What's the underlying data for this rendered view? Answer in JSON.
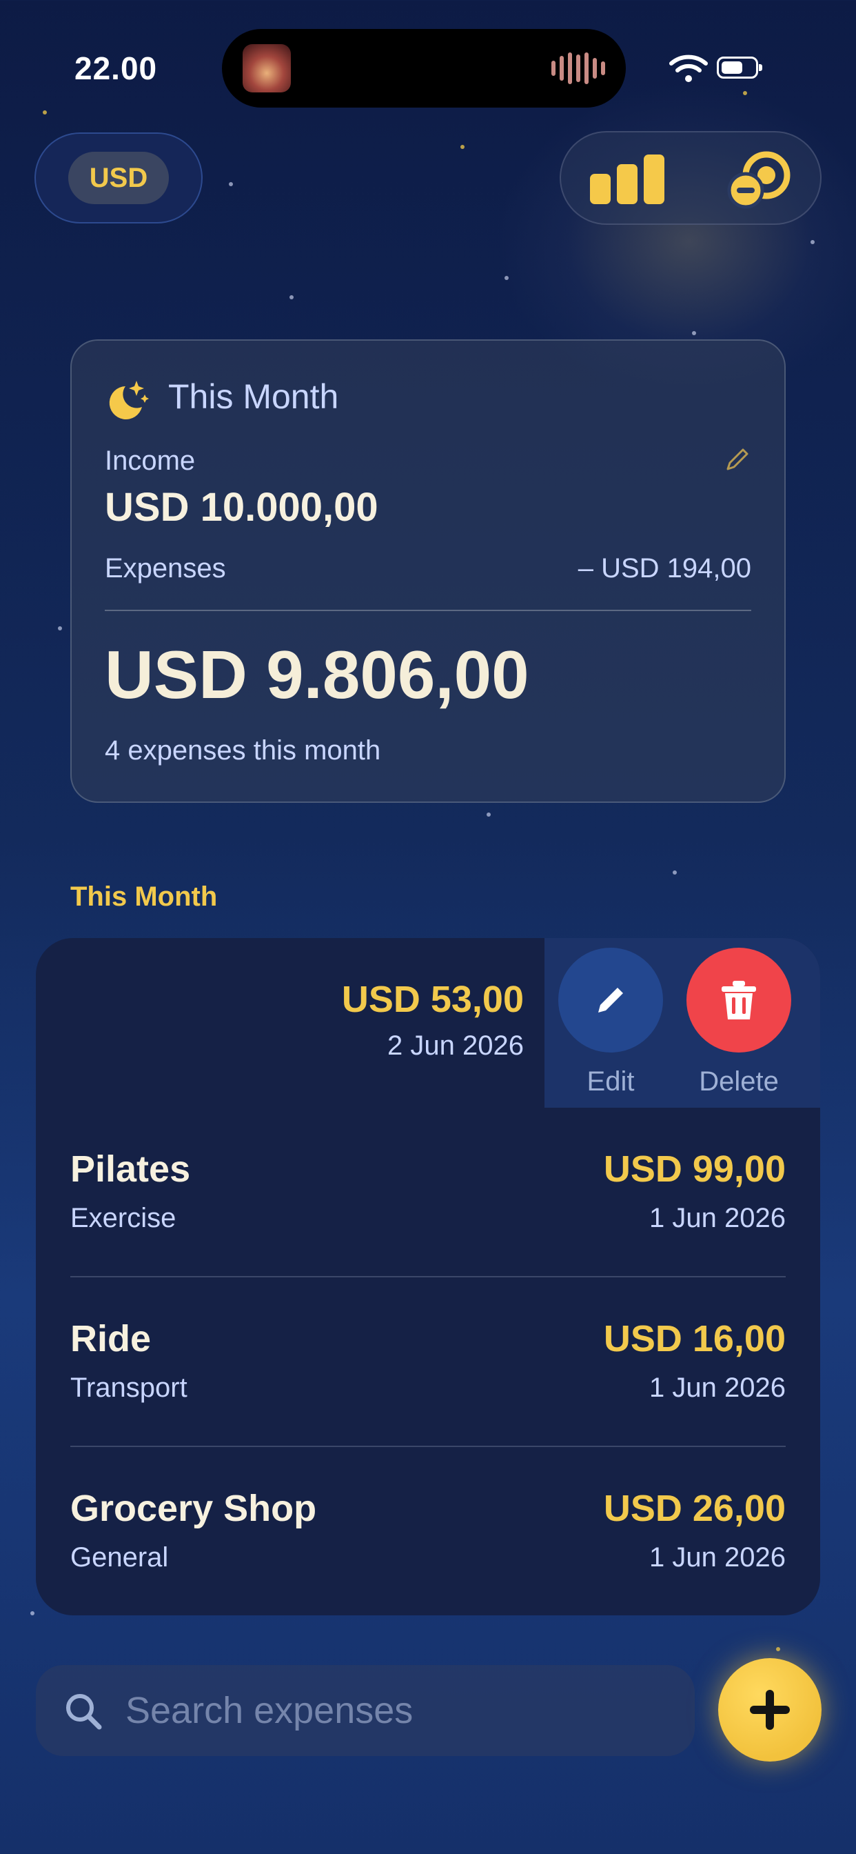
{
  "status_bar": {
    "time": "22.00"
  },
  "header": {
    "currency": "USD"
  },
  "summary": {
    "title": "This Month",
    "income_label": "Income",
    "income_value": "USD 10.000,00",
    "expenses_label": "Expenses",
    "expenses_value": "– USD 194,00",
    "balance_value": "USD 9.806,00",
    "count_text": "4 expenses this month"
  },
  "section": {
    "title": "This Month"
  },
  "swiped_row": {
    "amount": "USD 53,00",
    "date": "2 Jun 2026",
    "edit_label": "Edit",
    "delete_label": "Delete"
  },
  "expenses": [
    {
      "name": "Pilates",
      "category": "Exercise",
      "amount": "USD 99,00",
      "date": "1 Jun 2026"
    },
    {
      "name": "Ride",
      "category": "Transport",
      "amount": "USD 16,00",
      "date": "1 Jun 2026"
    },
    {
      "name": "Grocery Shop",
      "category": "General",
      "amount": "USD 26,00",
      "date": "1 Jun 2026"
    }
  ],
  "search": {
    "placeholder": "Search expenses"
  },
  "icons": {
    "chart": "bar-chart-icon",
    "budget": "budget-remove-icon",
    "moon": "moon-stars-icon",
    "edit": "pencil-icon",
    "delete": "trash-icon",
    "search": "search-icon",
    "add": "plus-icon"
  },
  "colors": {
    "accent": "#F2C94C",
    "delete": "#F0444A",
    "card": "#152146",
    "background": "#132A5C"
  }
}
